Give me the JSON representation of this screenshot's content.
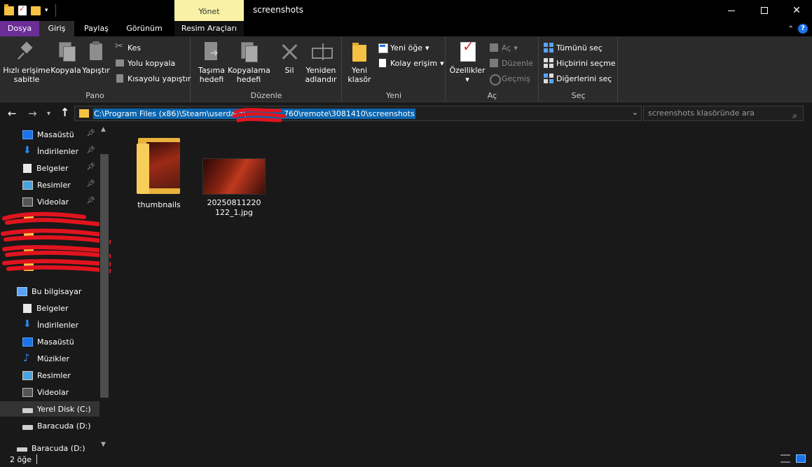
{
  "window": {
    "title": "screenshots",
    "context_tab": "Yönet",
    "minimize": "—",
    "close": "✕"
  },
  "tabs": {
    "dosya": "Dosya",
    "giris": "Giriş",
    "paylas": "Paylaş",
    "gorunum": "Görünüm",
    "resim_araclari": "Resim Araçları",
    "help": "?"
  },
  "ribbon": {
    "pano": {
      "label": "Pano",
      "pin": "Hızlı erişime sabitle",
      "copy": "Kopyala",
      "paste": "Yapıştır",
      "cut": "Kes",
      "copy_path": "Yolu kopyala",
      "paste_shortcut": "Kısayolu yapıştır"
    },
    "duzenle": {
      "label": "Düzenle",
      "move_to": "Taşıma hedefi",
      "copy_to": "Kopyalama hedefi",
      "delete": "Sil",
      "rename": "Yeniden adlandır"
    },
    "yeni": {
      "label": "Yeni",
      "new_folder": "Yeni klasör",
      "new_item": "Yeni öğe",
      "easy_access": "Kolay erişim"
    },
    "ac": {
      "label": "Aç",
      "properties": "Özellikler",
      "open": "Aç",
      "edit": "Düzenle",
      "history": "Geçmiş"
    },
    "sec": {
      "label": "Seç",
      "select_all": "Tümünü seç",
      "select_none": "Hiçbirini seçme",
      "invert": "Diğerlerini seç"
    }
  },
  "address": {
    "path": "C:\\Program Files (x86)\\Steam\\userdata\\",
    "path_tail": "760\\remote\\3081410\\screenshots",
    "search_placeholder": "screenshots klasöründe ara"
  },
  "sidebar": {
    "quick_access": [
      {
        "label": "Masaüstü",
        "icon": "desktop-icon"
      },
      {
        "label": "İndirilenler",
        "icon": "download-icon"
      },
      {
        "label": "Belgeler",
        "icon": "documents-icon"
      },
      {
        "label": "Resimler",
        "icon": "pictures-icon"
      },
      {
        "label": "Videolar",
        "icon": "videos-icon"
      }
    ],
    "this_pc": "Bu bilgisayar",
    "pc_items": [
      {
        "label": "Belgeler"
      },
      {
        "label": "İndirilenler"
      },
      {
        "label": "Masaüstü"
      },
      {
        "label": "Müzikler"
      },
      {
        "label": "Resimler"
      },
      {
        "label": "Videolar"
      },
      {
        "label": "Yerel Disk (C:)"
      },
      {
        "label": "Baracuda (D:)"
      }
    ],
    "drive": "Baracuda (D:)"
  },
  "files": [
    {
      "name": "thumbnails",
      "type": "folder"
    },
    {
      "name": "20250811220122_1.jpg",
      "type": "image"
    }
  ],
  "status": {
    "count": "2 öğe"
  },
  "colors": {
    "accent": "#0a64ad",
    "dosya_tab": "#6b2e96",
    "context_tab": "#f9f1a5"
  }
}
